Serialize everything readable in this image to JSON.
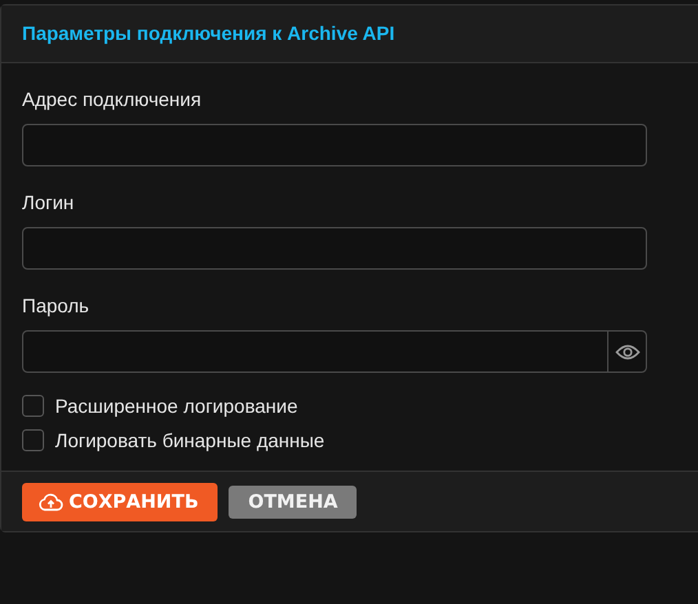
{
  "panel": {
    "title": "Параметры подключения к Archive API"
  },
  "fields": [
    {
      "kind": "text",
      "label": "Адрес подключения"
    },
    {
      "kind": "text",
      "label": "Логин"
    },
    {
      "kind": "password",
      "label": "Пароль"
    }
  ],
  "options": [
    {
      "label": "Расширенное логирование",
      "checked": false
    },
    {
      "label": "Логировать бинарные данные",
      "checked": false
    }
  ],
  "buttons": [
    {
      "kind": "primary",
      "label": "СОХРАНИТЬ"
    },
    {
      "kind": "secondary",
      "label": "ОТМЕНА"
    }
  ]
}
